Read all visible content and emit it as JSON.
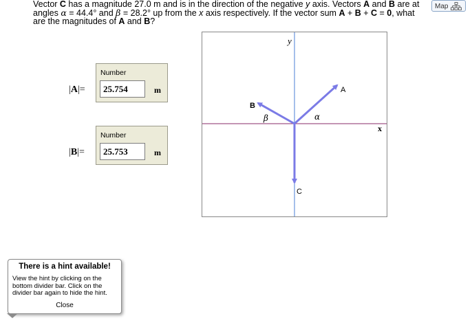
{
  "question": {
    "t1": "Vector ",
    "C": "C",
    "t2": " has a magnitude 27.0 m and is in the direction of the negative ",
    "y": "y",
    "t3": " axis. Vectors ",
    "A": "A",
    "t4": " and ",
    "B": "B",
    "t5": " are at angles ",
    "alpha": "α",
    "t6": " = 44.4° and ",
    "beta": "β",
    "t7": " = 28.2° up from the ",
    "x": "x",
    "t8": " axis respectively. If the vector sum ",
    "sumA": "A",
    "plus1": " + ",
    "sumB": "B",
    "plus2": " + ",
    "sumC": "C",
    "t9": " = ",
    "zero": "0",
    "t10": ", what are the magnitudes of ",
    "A2": "A",
    "t11": " and ",
    "B2": "B",
    "t12": "?"
  },
  "map_button": {
    "label": "Map"
  },
  "answer_A": {
    "bar1": "|",
    "symbol": "A",
    "bar2": "|",
    "equals": "=",
    "box_title": "Number",
    "value": "25.754",
    "unit": "m"
  },
  "answer_B": {
    "bar1": "|",
    "symbol": "B",
    "bar2": "|",
    "equals": "=",
    "box_title": "Number",
    "value": "25.753",
    "unit": "m"
  },
  "diagram": {
    "y_axis_label": "y",
    "x_axis_label": "x",
    "vector_A_label": "A",
    "vector_B_label": "B",
    "vector_C_label": "C",
    "alpha_label": "α",
    "beta_label": "β",
    "colors": {
      "vector": "#7b7be6",
      "y_axis": "#4a7fd6",
      "x_axis": "#8a2a6a",
      "frame": "#888888"
    }
  },
  "hint": {
    "title": "There is a hint available!",
    "body": "View the hint by clicking on the bottom divider bar. Click on the divider bar again to hide the hint.",
    "close_label": "Close"
  }
}
